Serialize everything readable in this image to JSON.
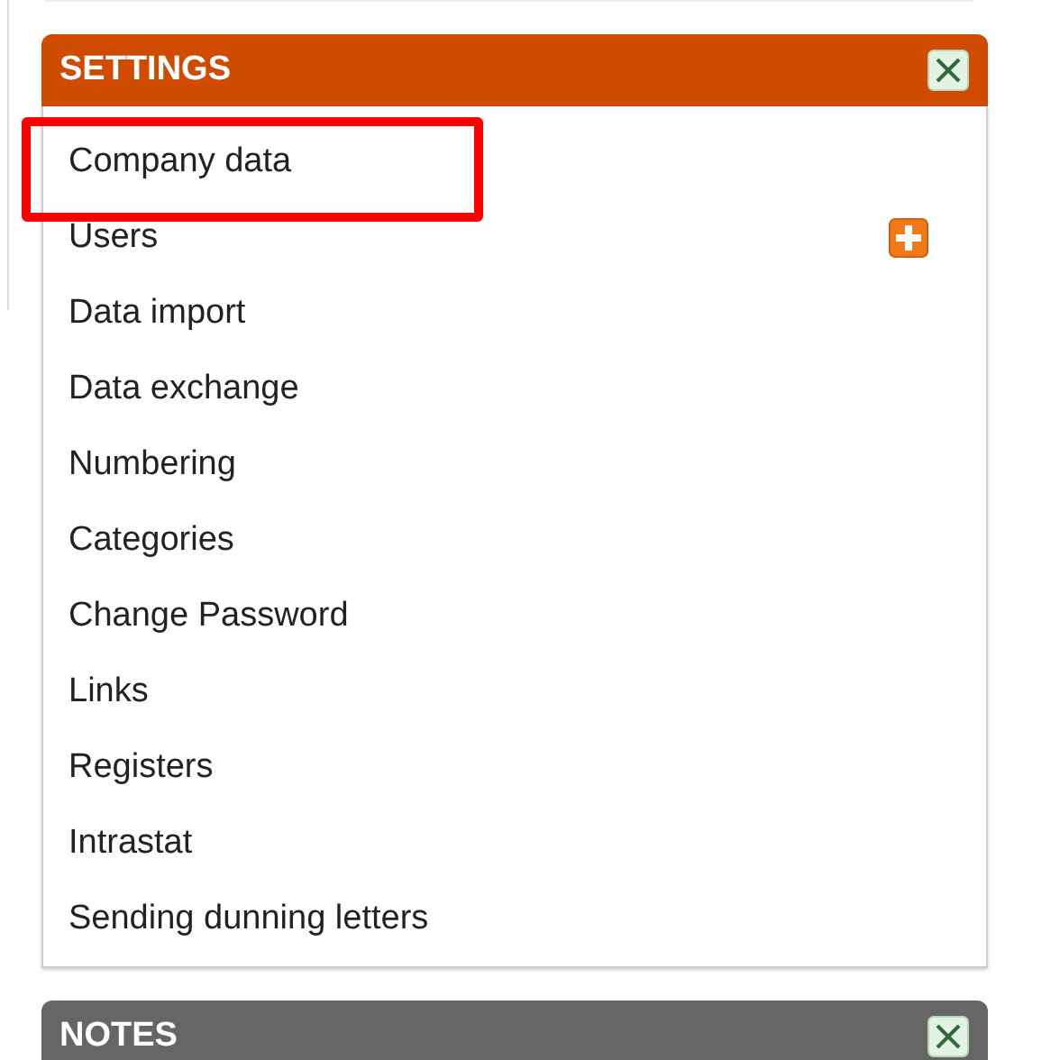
{
  "panels": [
    {
      "title": "SETTINGS",
      "color": "#cf4b00",
      "items": [
        {
          "label": "Company data",
          "highlighted": true,
          "add_button": false
        },
        {
          "label": "Users",
          "highlighted": false,
          "add_button": true
        },
        {
          "label": "Data import",
          "highlighted": false,
          "add_button": false
        },
        {
          "label": "Data exchange",
          "highlighted": false,
          "add_button": false
        },
        {
          "label": "Numbering",
          "highlighted": false,
          "add_button": false
        },
        {
          "label": "Categories",
          "highlighted": false,
          "add_button": false
        },
        {
          "label": "Change Password",
          "highlighted": false,
          "add_button": false
        },
        {
          "label": "Links",
          "highlighted": false,
          "add_button": false
        },
        {
          "label": "Registers",
          "highlighted": false,
          "add_button": false
        },
        {
          "label": "Intrastat",
          "highlighted": false,
          "add_button": false
        },
        {
          "label": "Sending dunning letters",
          "highlighted": false,
          "add_button": false
        }
      ]
    },
    {
      "title": "NOTES",
      "color": "#666666"
    }
  ]
}
